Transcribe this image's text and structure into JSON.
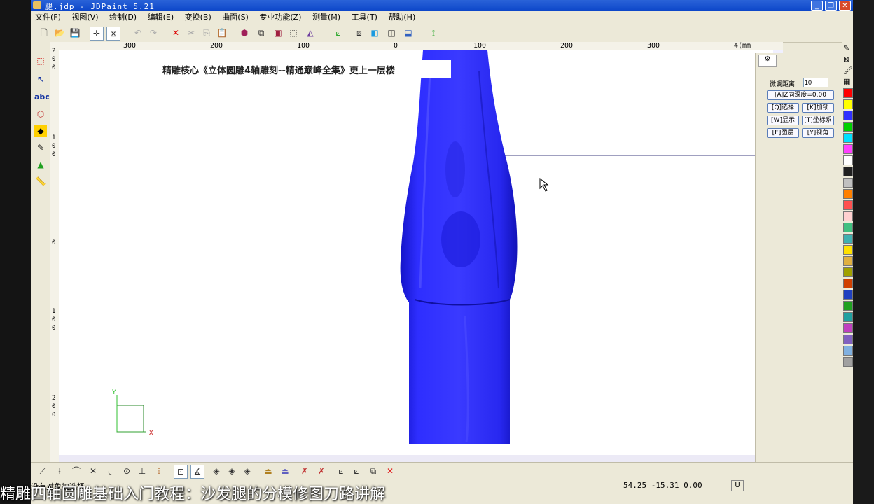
{
  "window": {
    "title": "腿.jdp - JDPaint 5.21"
  },
  "menu": [
    "文件(F)",
    "视图(V)",
    "绘制(D)",
    "编辑(E)",
    "变换(B)",
    "曲面(S)",
    "专业功能(Z)",
    "测量(M)",
    "工具(T)",
    "帮助(H)"
  ],
  "hruler_labels": [
    "300",
    "200",
    "100",
    "0",
    "100",
    "200",
    "300",
    "4(mm"
  ],
  "vruler_labels": [
    "2",
    "0",
    "0",
    "1",
    "0",
    "0",
    "0",
    "1",
    "0",
    "0",
    "2",
    "0",
    "0"
  ],
  "overlay_banner": "精雕核心《立体圆雕4轴雕刻--精通巅峰全集》更上一层楼",
  "panel": {
    "fine_tune_label": "微调距离",
    "fine_tune_value": "10",
    "z_depth": "[A]Z向深度=0.00",
    "select": "[Q]选择",
    "lock": "[K]加锁",
    "show": "[W]显示",
    "coord": "[T]坐标系",
    "layer": "[E]图层",
    "view": "[Y]视角"
  },
  "axis": {
    "x": "X",
    "y": "Y"
  },
  "status": {
    "message": "没有对象被选择",
    "coords": "54.25 -15.31 0.00",
    "mode": "U"
  },
  "caption": "精雕四轴圆雕基础入门教程：沙发腿的分模修图刀路讲解",
  "colors": {
    "model": "#1f1fe8",
    "title_bar": "#0c46c9",
    "palette": [
      "#ff0000",
      "#ffff00",
      "#3030ff",
      "#00d000",
      "#00e0ff",
      "#ff40ff",
      "#ffffff",
      "#202020",
      "#c0c0c0",
      "#ff8000",
      "#ff5050",
      "#ffd0d0",
      "#40c080",
      "#40b0b0",
      "#ffe000",
      "#e0b040",
      "#a0a000",
      "#d04000",
      "#2040c0",
      "#20a020",
      "#20a0a0",
      "#c040c0",
      "#8060c0",
      "#80b0e0",
      "#a0a0a0"
    ]
  }
}
